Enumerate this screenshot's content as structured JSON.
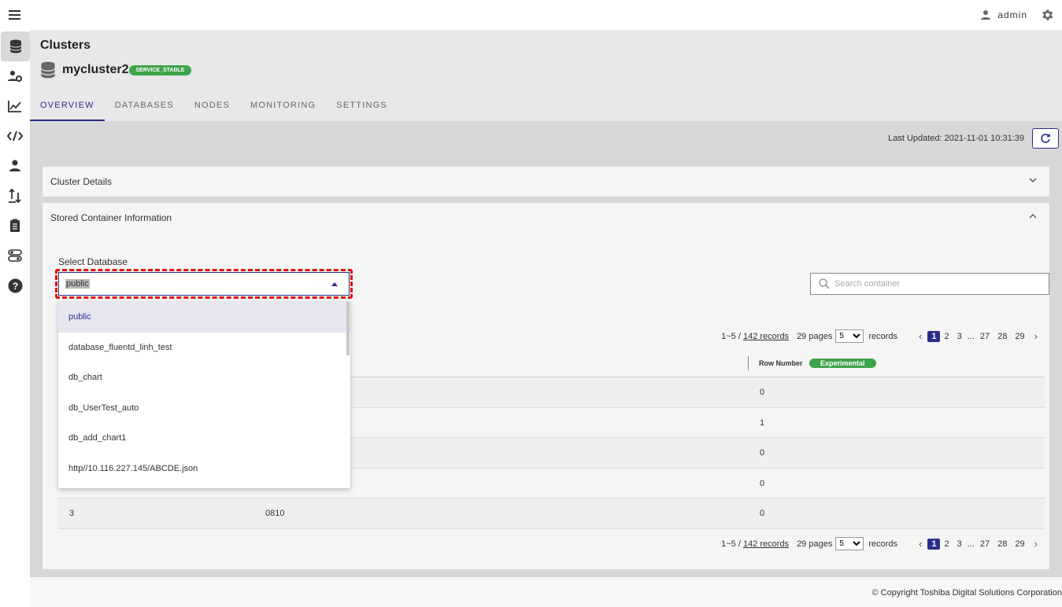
{
  "header": {
    "user": "admin"
  },
  "sidebar": {
    "items": [
      {
        "icon": "database-icon",
        "active": true
      },
      {
        "icon": "user-settings-icon"
      },
      {
        "icon": "chart-line-icon"
      },
      {
        "icon": "code-icon"
      },
      {
        "icon": "users-icon"
      },
      {
        "icon": "import-export-icon"
      },
      {
        "icon": "clipboard-icon"
      },
      {
        "icon": "toggles-icon"
      },
      {
        "icon": "help-icon"
      }
    ]
  },
  "page": {
    "title": "Clusters",
    "cluster_name": "mycluster2",
    "status": "SERVICE_STABLE",
    "tabs": [
      "OVERVIEW",
      "DATABASES",
      "NODES",
      "MONITORING",
      "SETTINGS"
    ]
  },
  "content": {
    "last_updated": "Last Updated: 2021-11-01 10:31:39",
    "panel_details": "Cluster Details",
    "panel_containers": "Stored Container Information",
    "select_label": "Select Database",
    "select_value": "public",
    "search_placeholder": "Search container",
    "pager": {
      "range": "1~5 / ",
      "records_link": "142 records",
      "pages": "29 pages",
      "page_size": "5",
      "records_label": "records",
      "p1": "1",
      "p2": "2",
      "p3": "3",
      "dots": "...",
      "p27": "27",
      "p28": "28",
      "p29": "29"
    },
    "table": {
      "col_rownum": "Row Number",
      "experimental": "Experimental",
      "rows": [
        {
          "c1": "",
          "c2": "",
          "c3": "0"
        },
        {
          "c1": "",
          "c2": "",
          "c3": "1"
        },
        {
          "c1": "",
          "c2": "",
          "c3": "0"
        },
        {
          "c1": "",
          "c2": "",
          "c3": "0"
        },
        {
          "c1": "3",
          "c2": "0810",
          "c3": "0"
        }
      ]
    },
    "dropdown": [
      "public",
      "database_fluentd_linh_test",
      "db_chart",
      "db_UserTest_auto",
      "db_add_chart1",
      "http//10.116.227.145/ABCDE.json"
    ]
  },
  "footer": "© Copyright Toshiba Digital Solutions Corporation",
  "colors": {
    "accent": "#2c2d8a",
    "success": "#3fa34d",
    "highlight": "#e01010"
  }
}
